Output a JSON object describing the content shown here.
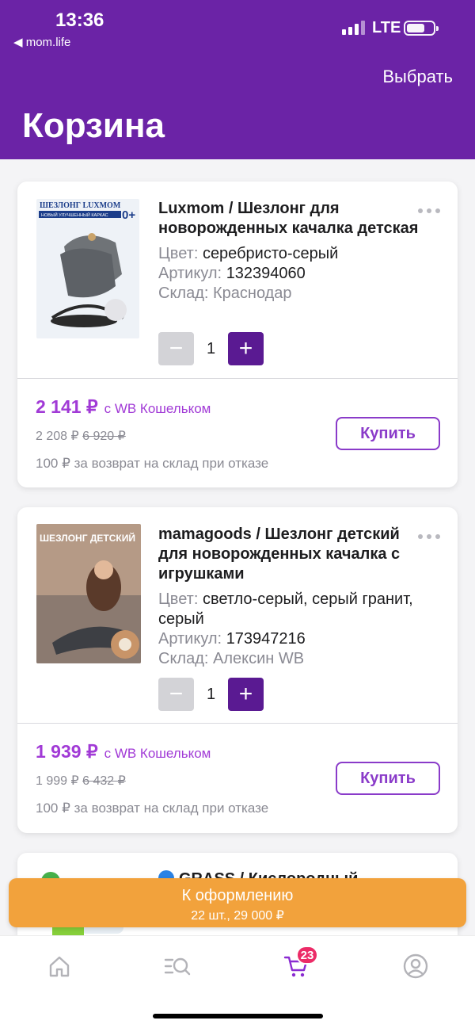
{
  "status": {
    "time": "13:36",
    "back": "◀ mom.life",
    "network": "LTE"
  },
  "header": {
    "select": "Выбрать",
    "title": "Корзина"
  },
  "items": [
    {
      "title": "Luxmom / Шезлонг для новорожденных качалка детская",
      "color_label": "Цвет:",
      "color": "серебристо-серый",
      "sku_label": "Артикул:",
      "sku": "132394060",
      "warehouse_label": "Склад:",
      "warehouse": "Краснодар",
      "qty": "1",
      "price": "2 141 ₽",
      "wallet": "с WB Кошельком",
      "price_old": "2 208 ₽",
      "price_strike": "6 920 ₽",
      "refund": "100 ₽ за возврат на склад при отказе",
      "buy": "Купить",
      "image_text": "ШЕЗЛОНГ LUXMOM",
      "image_sub": "НОВЫЙ УЛУЧШЕННЫЙ КАРКАС",
      "image_age": "0+"
    },
    {
      "title": "mamagoods / Шезлонг детский для новорожденных качалка с игрушками",
      "color_label": "Цвет:",
      "color": "светло-серый, серый гранит, серый",
      "sku_label": "Артикул:",
      "sku": "173947216",
      "warehouse_label": "Склад:",
      "warehouse": "Алексин WB",
      "qty": "1",
      "price": "1 939 ₽",
      "wallet": "с WB Кошельком",
      "price_old": "1 999 ₽",
      "price_strike": "6 432 ₽",
      "refund": "100 ₽ за возврат на склад при отказе",
      "buy": "Купить",
      "image_text": "ШЕЗЛОНГ ДЕТСКИЙ"
    },
    {
      "title": "GRASS / Кислородный"
    }
  ],
  "checkout": {
    "label": "К оформлению",
    "summary": "22 шт., 29 000 ₽"
  },
  "tabbar": {
    "cart_badge": "23"
  },
  "colors": {
    "brand": "#6b23a6",
    "accent": "#a13ad6",
    "checkout": "#f2a23c",
    "badge": "#ec2b67"
  }
}
